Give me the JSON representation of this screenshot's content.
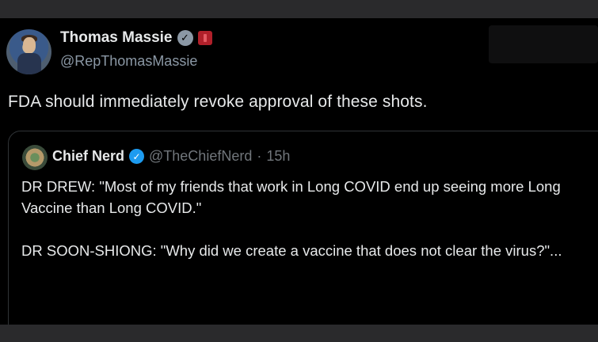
{
  "author": {
    "display_name": "Thomas Massie",
    "handle": "@RepThomasMassie",
    "verified_icon": "verified-badge-icon",
    "affiliation_icon": "congress-flag-icon"
  },
  "tweet": {
    "text": "FDA should immediately revoke approval of these shots."
  },
  "quoted": {
    "display_name": "Chief Nerd",
    "handle": "@TheChiefNerd",
    "separator": "·",
    "time": "15h",
    "paragraph_1": "DR DREW: \"Most of my friends that work in Long COVID end up seeing more Long Vaccine than Long COVID.\"",
    "paragraph_2": "DR SOON-SHIONG: \"Why did we create a vaccine that does not clear the virus?\"..."
  },
  "colors": {
    "background": "#000000",
    "text": "#e7e9ea",
    "muted": "#71767b",
    "verified_blue": "#1d9bf0",
    "verified_gray": "#8b98a5"
  }
}
